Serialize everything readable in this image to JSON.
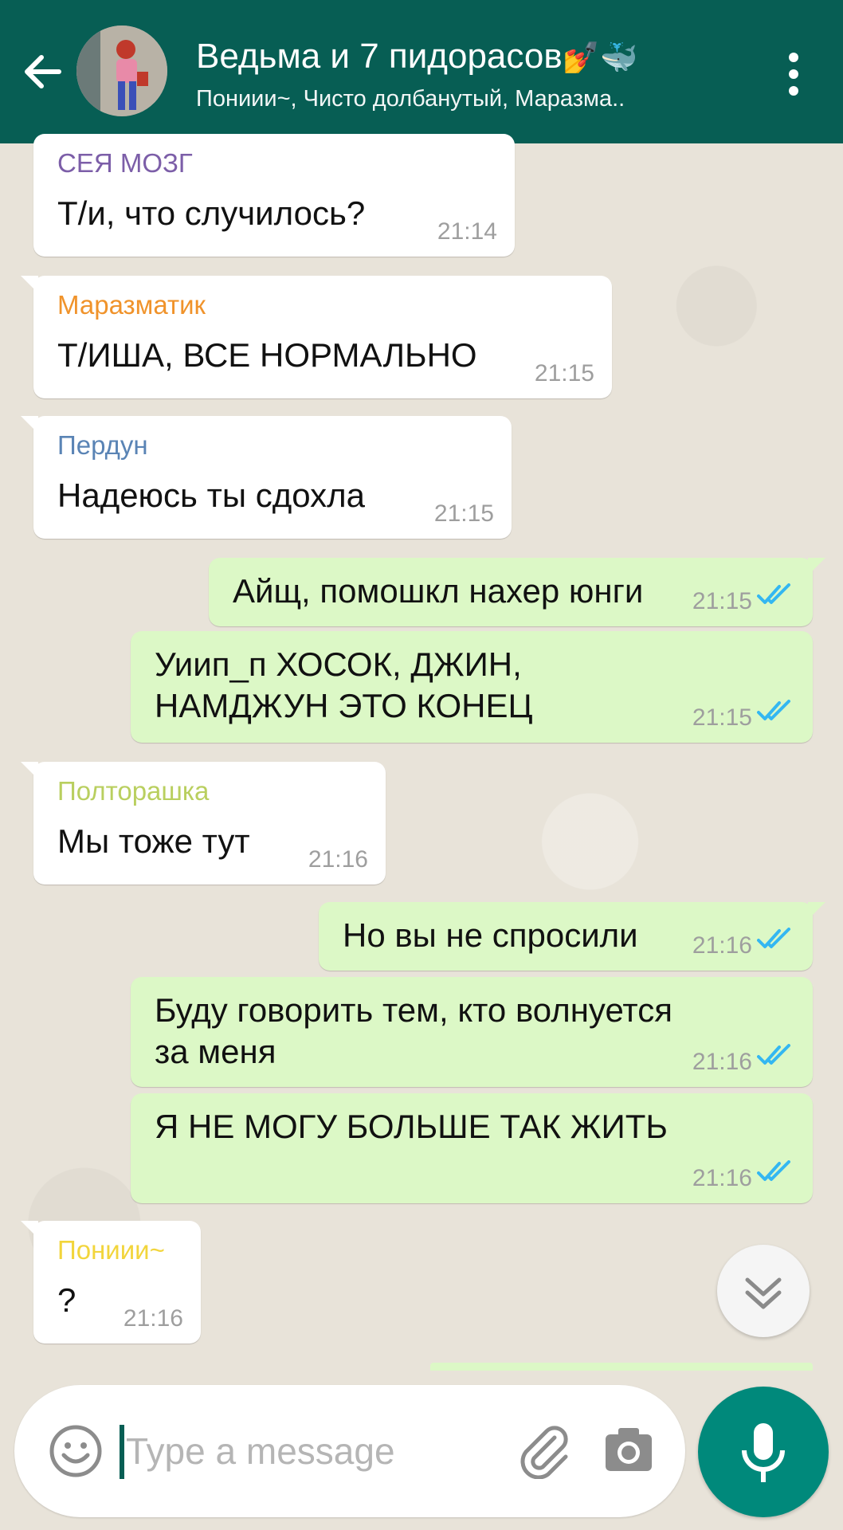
{
  "header": {
    "title": "Ведьма и 7 пидорасов",
    "title_emoji": "💅🐳",
    "subtitle": "Пониии~, Чисто долбанутый, Маразма.."
  },
  "messages": [
    {
      "direction": "in",
      "sender": "СЕЯ МОЗГ",
      "sender_color": "#7c5ea8",
      "text": "Т/и, что случилось?",
      "time": "21:14"
    },
    {
      "direction": "in",
      "sender": "Маразматик",
      "sender_color": "#f0932b",
      "text": "Т/ИША, ВСЕ НОРМАЛЬНО",
      "time": "21:15"
    },
    {
      "direction": "in",
      "sender": "Пердун",
      "sender_color": "#5a84b5",
      "text": "Надеюсь ты сдохла",
      "time": "21:15"
    },
    {
      "direction": "out",
      "text": "Айщ, помошкл нахер юнги",
      "time": "21:15"
    },
    {
      "direction": "out",
      "text": "Уиип_п ХОСОК, ДЖИН, НАМДЖУН ЭТО КОНЕЦ",
      "time": "21:15"
    },
    {
      "direction": "in",
      "sender": "Полторашка",
      "sender_color": "#b9cf5f",
      "text": "Мы тоже тут",
      "time": "21:16"
    },
    {
      "direction": "out",
      "text": "Но вы не спросили",
      "time": "21:16"
    },
    {
      "direction": "out",
      "text": "Буду говорить тем, кто волнуется за меня",
      "time": "21:16"
    },
    {
      "direction": "out",
      "text": "Я НЕ МОГУ БОЛЬШЕ ТАК ЖИТЬ",
      "time": "21:16"
    },
    {
      "direction": "in",
      "sender": "Пониии~",
      "sender_color": "#f2d53c",
      "text": "?",
      "time": "21:16"
    }
  ],
  "input": {
    "placeholder": "Type a message"
  },
  "colors": {
    "header_bg": "#075e54",
    "outgoing_bubble": "#dcf8c6",
    "incoming_bubble": "#ffffff",
    "read_ticks": "#34b7f1",
    "mic_button": "#00897b"
  },
  "icons": [
    "back-arrow-icon",
    "more-vert-icon",
    "double-chevron-down-icon",
    "emoji-icon",
    "attachment-icon",
    "camera-icon",
    "mic-icon",
    "double-check-icon"
  ]
}
